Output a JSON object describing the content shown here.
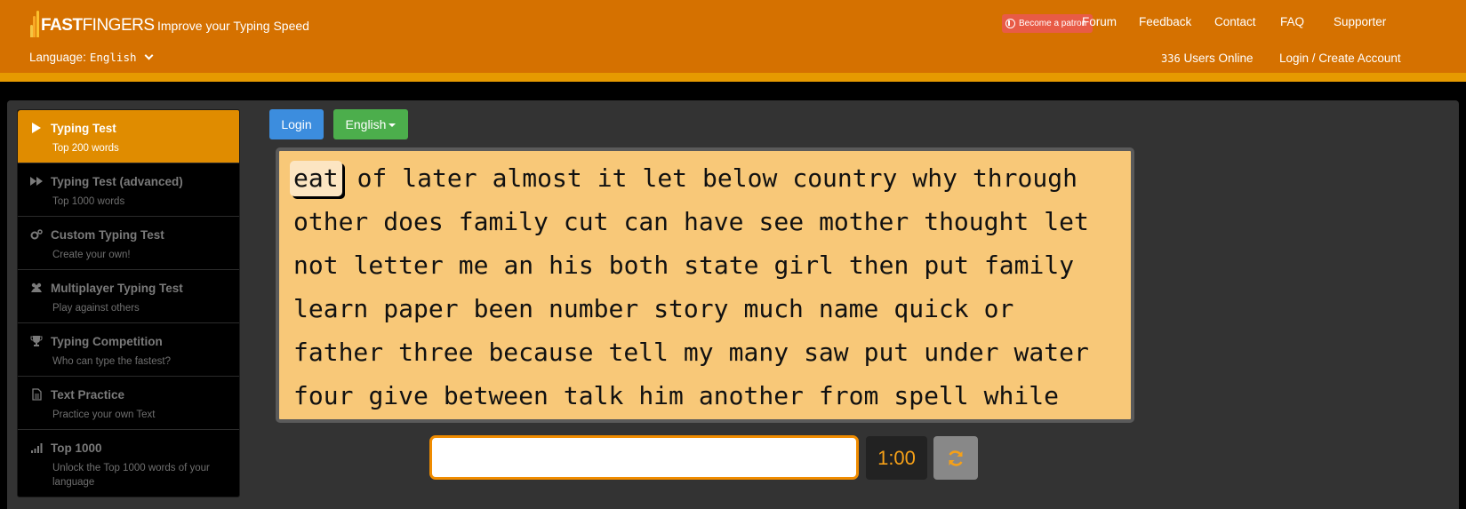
{
  "header": {
    "logo_bold": "FAST",
    "logo_thin": "FINGERS",
    "tagline": "Improve your Typing Speed",
    "language_label": "Language:",
    "language_value": "English",
    "patron_label": "Become a patron",
    "nav": [
      "Forum",
      "Feedback",
      "Contact",
      "FAQ",
      "Supporter"
    ],
    "users_online_count": "336",
    "users_online_label": "Users Online",
    "login_create": "Login / Create Account"
  },
  "sidebar": {
    "items": [
      {
        "title": "Typing Test",
        "subtitle": "Top 200 words",
        "icon": "play-icon",
        "active": true
      },
      {
        "title": "Typing Test (advanced)",
        "subtitle": "Top 1000 words",
        "icon": "fast-forward-icon",
        "active": false
      },
      {
        "title": "Custom Typing Test",
        "subtitle": "Create your own!",
        "icon": "gears-icon",
        "active": false
      },
      {
        "title": "Multiplayer Typing Test",
        "subtitle": "Play against others",
        "icon": "users-icon",
        "active": false
      },
      {
        "title": "Typing Competition",
        "subtitle": "Who can type the fastest?",
        "icon": "trophy-icon",
        "active": false
      },
      {
        "title": "Text Practice",
        "subtitle": "Practice your own Text",
        "icon": "document-icon",
        "active": false
      },
      {
        "title": "Top 1000",
        "subtitle": "Unlock the Top 1000 words of your language",
        "icon": "signal-bars-icon",
        "active": false
      }
    ]
  },
  "toolbar": {
    "login_label": "Login",
    "language_label": "English"
  },
  "words": {
    "lines": [
      [
        "eat",
        "of",
        "later",
        "almost",
        "it",
        "let",
        "below",
        "country",
        "why",
        "through"
      ],
      [
        "other",
        "does",
        "family",
        "cut",
        "can",
        "have",
        "see",
        "mother",
        "thought",
        "let"
      ],
      [
        "not",
        "letter",
        "me",
        "an",
        "his",
        "both",
        "state",
        "girl",
        "then",
        "put",
        "family"
      ],
      [
        "learn",
        "paper",
        "been",
        "number",
        "story",
        "much",
        "name",
        "quick",
        "or"
      ],
      [
        "father",
        "three",
        "because",
        "tell",
        "my",
        "many",
        "saw",
        "put",
        "under",
        "water"
      ],
      [
        "four",
        "give",
        "between",
        "talk",
        "him",
        "another",
        "from",
        "spell",
        "while"
      ]
    ],
    "current_word": "eat"
  },
  "typing": {
    "input_value": "",
    "timer": "1:00"
  },
  "colors": {
    "header": "#d57100",
    "accent": "#e08c00",
    "words_bg": "#f8c878",
    "timer_text": "#f5a018"
  }
}
